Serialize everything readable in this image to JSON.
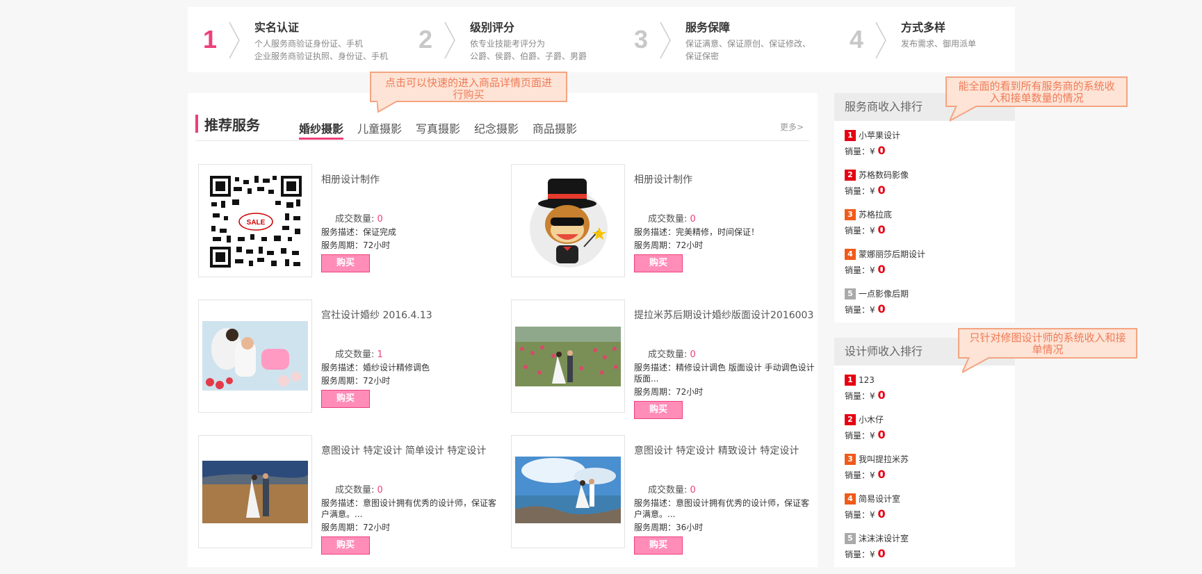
{
  "steps": [
    {
      "num": "1",
      "title": "实名认证",
      "desc1": "个人服务商验证身份证、手机",
      "desc2": "企业服务商验证执照、身份证、手机"
    },
    {
      "num": "2",
      "title": "级别评分",
      "desc1": "依专业技能考评分为",
      "desc2": "公爵、侯爵、伯爵、子爵、男爵"
    },
    {
      "num": "3",
      "title": "服务保障",
      "desc1": "保证满意、保证原创、保证修改、",
      "desc2": "保证保密"
    },
    {
      "num": "4",
      "title": "方式多样",
      "desc1": "发布需求、御用派单",
      "desc2": ""
    }
  ],
  "main": {
    "title": "推荐服务",
    "tabs": [
      "婚纱摄影",
      "儿童摄影",
      "写真摄影",
      "纪念摄影",
      "商品摄影"
    ],
    "more": "更多>",
    "labels": {
      "deal": "成交数量:",
      "buy": "购买"
    },
    "cards": [
      {
        "name": "相册设计制作",
        "count": "0",
        "desc": "服务描述：保证完成",
        "period": "服务周期：72小时"
      },
      {
        "name": "相册设计制作",
        "count": "0",
        "desc": "服务描述：完美精修，时间保证！",
        "period": "服务周期：72小时"
      },
      {
        "name": "宫社设计婚纱 2016.4.13",
        "count": "1",
        "desc": "服务描述：婚纱设计精修调色",
        "period": "服务周期：72小时"
      },
      {
        "name": "提拉米苏后期设计婚纱版面设计2016003",
        "count": "0",
        "desc": "服务描述：精修设计调色 版面设计 手动调色设计版面...",
        "period": "服务周期：72小时"
      },
      {
        "name": "意图设计 特定设计 简单设计 特定设计",
        "count": "0",
        "desc": "服务描述：意图设计拥有优秀的设计师，保证客户满意。...",
        "period": "服务周期：72小时"
      },
      {
        "name": "意图设计 特定设计 精致设计 特定设计",
        "count": "0",
        "desc": "服务描述：意图设计拥有优秀的设计师，保证客户满意。...",
        "period": "服务周期：36小时"
      }
    ]
  },
  "rank1": {
    "title": "服务商收入排行",
    "sales_label": "销量：¥",
    "items": [
      {
        "rank": "1",
        "name": "小苹果设计",
        "sales": "0"
      },
      {
        "rank": "2",
        "name": "苏格数码影像",
        "sales": "0"
      },
      {
        "rank": "3",
        "name": "苏格拉底",
        "sales": "0"
      },
      {
        "rank": "4",
        "name": "蒙娜丽莎后期设计",
        "sales": "0"
      },
      {
        "rank": "5",
        "name": "一点影像后期",
        "sales": "0"
      }
    ]
  },
  "rank2": {
    "title": "设计师收入排行",
    "sales_label": "销量：¥",
    "items": [
      {
        "rank": "1",
        "name": "123",
        "sales": "0"
      },
      {
        "rank": "2",
        "name": "小木仔",
        "sales": "0"
      },
      {
        "rank": "3",
        "name": "我叫提拉米苏",
        "sales": "0"
      },
      {
        "rank": "4",
        "name": "简易设计室",
        "sales": "0"
      },
      {
        "rank": "5",
        "name": "沫沫沫设计室",
        "sales": "0"
      }
    ]
  },
  "callouts": {
    "c1": "点击可以快速的进入商品详情页面进行购买",
    "c2": "能全面的看到所有服务商的系统收入和接单数量的情况",
    "c3": "只针对修图设计师的系统收入和接单情况"
  },
  "colors": {
    "accent": "#ee3f7a",
    "rank1": "#e60012",
    "rank2": "#e60012",
    "rank3": "#f05a1a",
    "rank4": "#f05a1a",
    "rank5": "#aaaaaa"
  }
}
